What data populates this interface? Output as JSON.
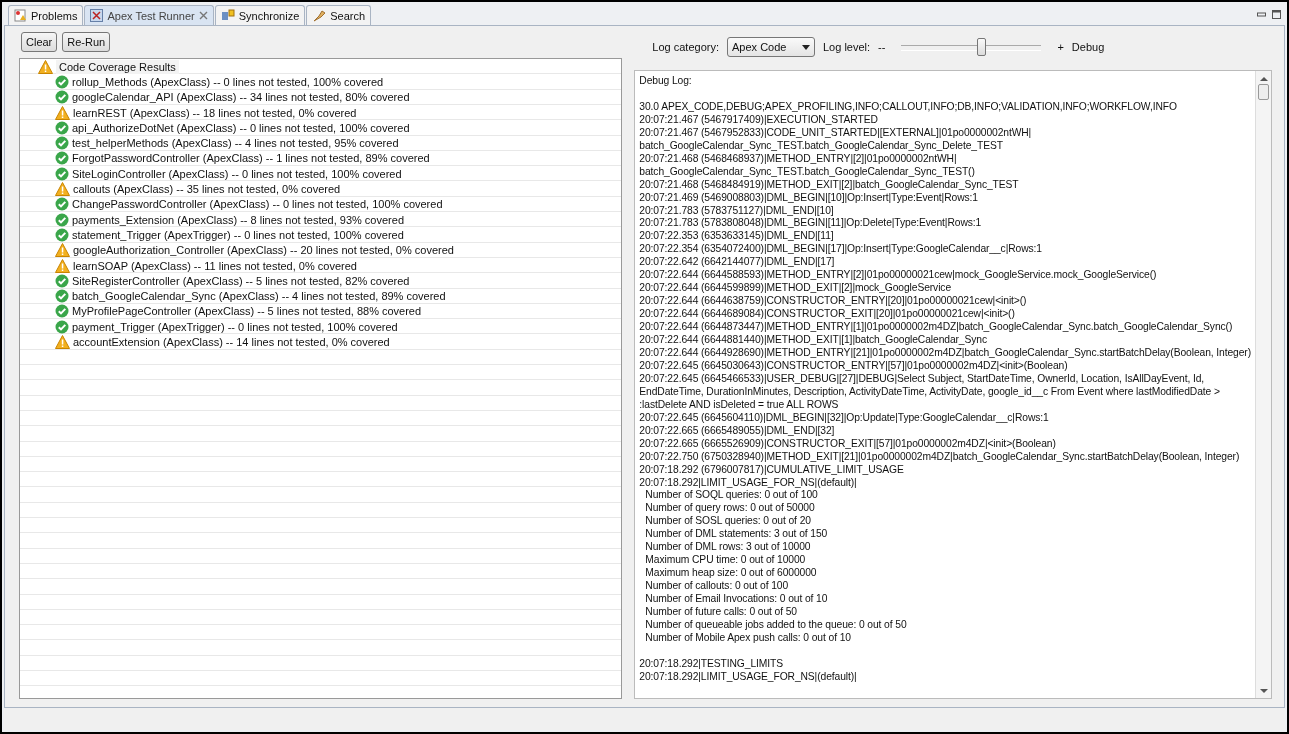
{
  "tabs": [
    {
      "label": "Problems",
      "kind": "problems",
      "selected": false,
      "closable": false
    },
    {
      "label": "Apex Test Runner",
      "kind": "runner",
      "selected": true,
      "closable": true
    },
    {
      "label": "Synchronize",
      "kind": "sync",
      "selected": false,
      "closable": false
    },
    {
      "label": "Search",
      "kind": "search",
      "selected": false,
      "closable": false
    }
  ],
  "toolbar": {
    "buttons": [
      "Clear",
      "Re-Run"
    ]
  },
  "coverage": {
    "root": {
      "label": "Code Coverage Results",
      "kind": "warning",
      "selected": true
    },
    "items": [
      {
        "label": "rollup_Methods (ApexClass) -- 0 lines not tested, 100% covered",
        "kind": "ok",
        "selected": false
      },
      {
        "label": "googleCalendar_API (ApexClass) -- 34 lines not tested, 80% covered",
        "kind": "ok",
        "selected": false
      },
      {
        "label": "learnREST (ApexClass) -- 18 lines not tested, 0% covered",
        "kind": "warning",
        "selected": false
      },
      {
        "label": "api_AuthorizeDotNet (ApexClass) -- 0 lines not tested, 100% covered",
        "kind": "ok",
        "selected": false
      },
      {
        "label": "test_helperMethods (ApexClass) -- 4 lines not tested, 95% covered",
        "kind": "ok",
        "selected": false
      },
      {
        "label": "ForgotPasswordController (ApexClass) -- 1 lines not tested, 89% covered",
        "kind": "ok",
        "selected": false
      },
      {
        "label": "SiteLoginController (ApexClass) -- 0 lines not tested, 100% covered",
        "kind": "ok",
        "selected": false
      },
      {
        "label": "callouts (ApexClass) -- 35 lines not tested, 0% covered",
        "kind": "warning",
        "selected": false
      },
      {
        "label": "ChangePasswordController (ApexClass) -- 0 lines not tested, 100% covered",
        "kind": "ok",
        "selected": false
      },
      {
        "label": "payments_Extension (ApexClass) -- 8 lines not tested, 93% covered",
        "kind": "ok",
        "selected": false
      },
      {
        "label": "statement_Trigger (ApexTrigger) -- 0 lines not tested, 100% covered",
        "kind": "ok",
        "selected": false
      },
      {
        "label": "googleAuthorization_Controller (ApexClass) -- 20 lines not tested, 0% covered",
        "kind": "warning",
        "selected": false
      },
      {
        "label": "learnSOAP (ApexClass) -- 11 lines not tested, 0% covered",
        "kind": "warning",
        "selected": false
      },
      {
        "label": "SiteRegisterController (ApexClass) -- 5 lines not tested, 82% covered",
        "kind": "ok",
        "selected": false
      },
      {
        "label": "batch_GoogleCalendar_Sync (ApexClass) -- 4 lines not tested, 89% covered",
        "kind": "ok",
        "selected": false
      },
      {
        "label": "MyProfilePageController (ApexClass) -- 5 lines not tested, 88% covered",
        "kind": "ok",
        "selected": false
      },
      {
        "label": "payment_Trigger (ApexTrigger) -- 0 lines not tested, 100% covered",
        "kind": "ok",
        "selected": false
      },
      {
        "label": "accountExtension (ApexClass) -- 14 lines not tested, 0% covered",
        "kind": "warning",
        "selected": false
      }
    ]
  },
  "log_settings": {
    "category_label": "Log category:",
    "category_value": "Apex Code",
    "level_label": "Log level:",
    "minus": "--",
    "plus": "+",
    "level": 0.57,
    "level_name": "Debug"
  },
  "debug_log": {
    "title": "Debug Log:",
    "lines": [
      {
        "text": "30.0 APEX_CODE,DEBUG;APEX_PROFILING,INFO;CALLOUT,INFO;DB,INFO;VALIDATION,INFO;WORKFLOW,INFO",
        "gap_before": true,
        "indent": false
      },
      {
        "text": "20:07:21.467 (5467917409)|EXECUTION_STARTED",
        "gap_before": false,
        "indent": false
      },
      {
        "text": "20:07:21.467 (5467952833)|CODE_UNIT_STARTED|[EXTERNAL]|01po0000002ntWH|",
        "gap_before": false,
        "indent": false
      },
      {
        "text": "batch_GoogleCalendar_Sync_TEST.batch_GoogleCalendar_Sync_Delete_TEST",
        "gap_before": false,
        "indent": false
      },
      {
        "text": "20:07:21.468 (5468468937)|METHOD_ENTRY|[2]|01po0000002ntWH|",
        "gap_before": false,
        "indent": false
      },
      {
        "text": "batch_GoogleCalendar_Sync_TEST.batch_GoogleCalendar_Sync_TEST()",
        "gap_before": false,
        "indent": false
      },
      {
        "text": "20:07:21.468 (5468484919)|METHOD_EXIT|[2]|batch_GoogleCalendar_Sync_TEST",
        "gap_before": false,
        "indent": false
      },
      {
        "text": "20:07:21.469 (5469008803)|DML_BEGIN|[10]|Op:Insert|Type:Event|Rows:1",
        "gap_before": false,
        "indent": false
      },
      {
        "text": "20:07:21.783 (5783751127)|DML_END|[10]",
        "gap_before": false,
        "indent": false
      },
      {
        "text": "20:07:21.783 (5783808048)|DML_BEGIN|[11]|Op:Delete|Type:Event|Rows:1",
        "gap_before": false,
        "indent": false
      },
      {
        "text": "20:07:22.353 (6353633145)|DML_END|[11]",
        "gap_before": false,
        "indent": false
      },
      {
        "text": "20:07:22.354 (6354072400)|DML_BEGIN|[17]|Op:Insert|Type:GoogleCalendar__c|Rows:1",
        "gap_before": false,
        "indent": false
      },
      {
        "text": "20:07:22.642 (6642144077)|DML_END|[17]",
        "gap_before": false,
        "indent": false
      },
      {
        "text": "20:07:22.644 (6644588593)|METHOD_ENTRY|[2]|01po00000021cew|mock_GoogleService.mock_GoogleService()",
        "gap_before": false,
        "indent": false
      },
      {
        "text": "20:07:22.644 (6644599899)|METHOD_EXIT|[2]|mock_GoogleService",
        "gap_before": false,
        "indent": false
      },
      {
        "text": "20:07:22.644 (6644638759)|CONSTRUCTOR_ENTRY|[20]|01po00000021cew|<init>()",
        "gap_before": false,
        "indent": false
      },
      {
        "text": "20:07:22.644 (6644689084)|CONSTRUCTOR_EXIT|[20]|01po00000021cew|<init>()",
        "gap_before": false,
        "indent": false
      },
      {
        "text": "20:07:22.644 (6644873447)|METHOD_ENTRY|[1]|01po0000002m4DZ|batch_GoogleCalendar_Sync.batch_GoogleCalendar_Sync()",
        "gap_before": false,
        "indent": false
      },
      {
        "text": "20:07:22.644 (6644881440)|METHOD_EXIT|[1]|batch_GoogleCalendar_Sync",
        "gap_before": false,
        "indent": false
      },
      {
        "text": "20:07:22.644 (6644928690)|METHOD_ENTRY|[21]|01po0000002m4DZ|batch_GoogleCalendar_Sync.startBatchDelay(Boolean, Integer)",
        "gap_before": false,
        "indent": false
      },
      {
        "text": "20:07:22.645 (6645030643)|CONSTRUCTOR_ENTRY|[57]|01po0000002m4DZ|<init>(Boolean)",
        "gap_before": false,
        "indent": false
      },
      {
        "text": "20:07:22.645 (6645466533)|USER_DEBUG|[27]|DEBUG|Select Subject, StartDateTime, OwnerId, Location, IsAllDayEvent, Id,",
        "gap_before": false,
        "indent": false
      },
      {
        "text": "EndDateTime, DurationInMinutes, Description, ActivityDateTime, ActivityDate, google_id__c From Event where lastModifiedDate >",
        "gap_before": false,
        "indent": false
      },
      {
        "text": ":lastDelete AND isDeleted = true ALL ROWS",
        "gap_before": false,
        "indent": false
      },
      {
        "text": "20:07:22.645 (6645604110)|DML_BEGIN|[32]|Op:Update|Type:GoogleCalendar__c|Rows:1",
        "gap_before": false,
        "indent": false
      },
      {
        "text": "20:07:22.665 (6665489055)|DML_END|[32]",
        "gap_before": false,
        "indent": false
      },
      {
        "text": "20:07:22.665 (6665526909)|CONSTRUCTOR_EXIT|[57]|01po0000002m4DZ|<init>(Boolean)",
        "gap_before": false,
        "indent": false
      },
      {
        "text": "20:07:22.750 (6750328940)|METHOD_EXIT|[21]|01po0000002m4DZ|batch_GoogleCalendar_Sync.startBatchDelay(Boolean, Integer)",
        "gap_before": false,
        "indent": false
      },
      {
        "text": "20:07:18.292 (6796007817)|CUMULATIVE_LIMIT_USAGE",
        "gap_before": false,
        "indent": false
      },
      {
        "text": "20:07:18.292|LIMIT_USAGE_FOR_NS|(default)|",
        "gap_before": false,
        "indent": false
      },
      {
        "text": "Number of SOQL queries: 0 out of 100",
        "gap_before": false,
        "indent": true
      },
      {
        "text": "Number of query rows: 0 out of 50000",
        "gap_before": false,
        "indent": true
      },
      {
        "text": "Number of SOSL queries: 0 out of 20",
        "gap_before": false,
        "indent": true
      },
      {
        "text": "Number of DML statements: 3 out of 150",
        "gap_before": false,
        "indent": true
      },
      {
        "text": "Number of DML rows: 3 out of 10000",
        "gap_before": false,
        "indent": true
      },
      {
        "text": "Maximum CPU time: 0 out of 10000",
        "gap_before": false,
        "indent": true
      },
      {
        "text": "Maximum heap size: 0 out of 6000000",
        "gap_before": false,
        "indent": true
      },
      {
        "text": "Number of callouts: 0 out of 100",
        "gap_before": false,
        "indent": true
      },
      {
        "text": "Number of Email Invocations: 0 out of 10",
        "gap_before": false,
        "indent": true
      },
      {
        "text": "Number of future calls: 0 out of 50",
        "gap_before": false,
        "indent": true
      },
      {
        "text": "Number of queueable jobs added to the queue: 0 out of 50",
        "gap_before": false,
        "indent": true
      },
      {
        "text": "Number of Mobile Apex push calls: 0 out of 10",
        "gap_before": false,
        "indent": true
      },
      {
        "text": "20:07:18.292|TESTING_LIMITS",
        "gap_before": true,
        "indent": false
      },
      {
        "text": "20:07:18.292|LIMIT_USAGE_FOR_NS|(default)|",
        "gap_before": false,
        "indent": false
      }
    ]
  }
}
